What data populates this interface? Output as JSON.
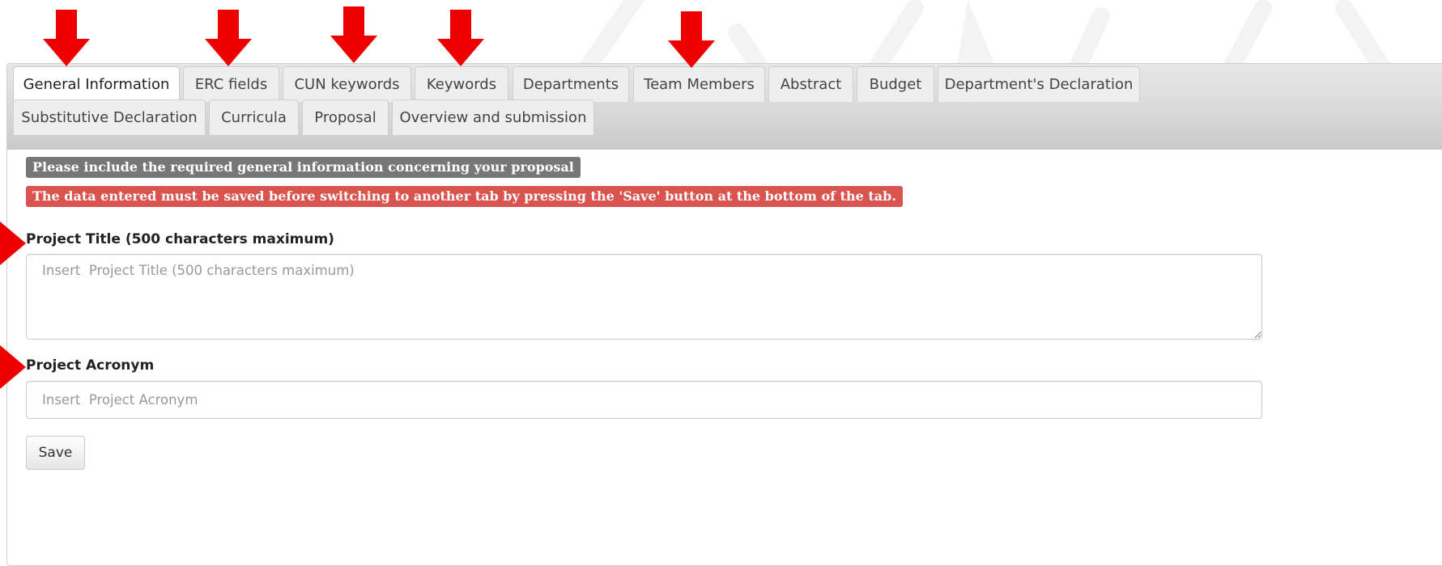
{
  "tabs_row1": [
    {
      "label": "General Information",
      "active": true
    },
    {
      "label": "ERC fields"
    },
    {
      "label": "CUN keywords"
    },
    {
      "label": "Keywords"
    },
    {
      "label": "Departments"
    },
    {
      "label": "Team Members"
    },
    {
      "label": "Abstract"
    },
    {
      "label": "Budget"
    },
    {
      "label": "Department's Declaration"
    }
  ],
  "tabs_row2": [
    {
      "label": "Substitutive Declaration"
    },
    {
      "label": "Curricula"
    },
    {
      "label": "Proposal"
    },
    {
      "label": "Overview and submission"
    }
  ],
  "notices": {
    "info": "Please include the required general information concerning your proposal",
    "warning": "The data entered must be saved before switching to another tab by pressing the 'Save' button at the bottom of the tab."
  },
  "form": {
    "title_label": "Project Title (500 characters maximum)",
    "title_placeholder": "Insert  Project Title (500 characters maximum)",
    "title_value": "",
    "acronym_label": "Project Acronym",
    "acronym_placeholder": "Insert  Project Acronym",
    "acronym_value": "",
    "save_label": "Save"
  },
  "annotations": {
    "arrow_color": "#ee0000",
    "arrows": [
      "down-arrow",
      "down-arrow",
      "down-arrow",
      "down-arrow",
      "down-arrow",
      "right-arrow",
      "right-arrow"
    ]
  },
  "colors": {
    "info_badge": "#777777",
    "warning_badge": "#d9534f",
    "tabbar": "#d9d9d9"
  }
}
